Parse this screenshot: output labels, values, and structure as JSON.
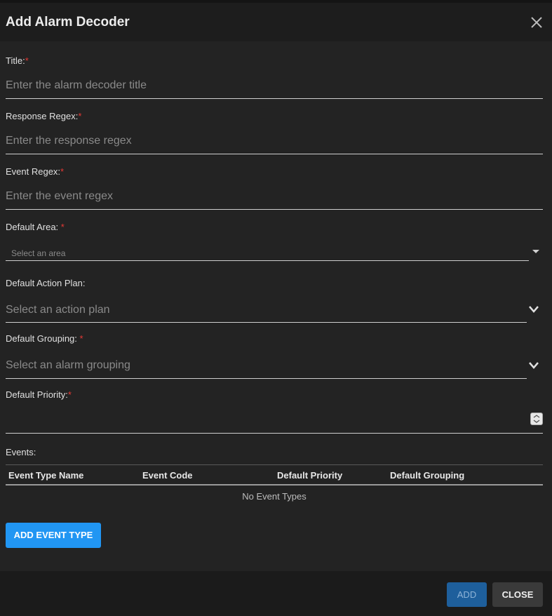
{
  "dialog": {
    "title": "Add Alarm Decoder"
  },
  "form": {
    "title": {
      "label": "Title:",
      "required_mark": "*",
      "placeholder": "Enter the alarm decoder title"
    },
    "response_regex": {
      "label": "Response Regex:",
      "required_mark": "*",
      "placeholder": "Enter the response regex"
    },
    "event_regex": {
      "label": "Event Regex:",
      "required_mark": "*",
      "placeholder": "Enter the event regex"
    },
    "default_area": {
      "label": "Default Area: ",
      "required_mark": "*",
      "placeholder": "Select an area"
    },
    "default_action_plan": {
      "label": "Default Action Plan:",
      "placeholder": "Select an action plan"
    },
    "default_grouping": {
      "label": "Default Grouping: ",
      "required_mark": "*",
      "placeholder": "Select an alarm grouping"
    },
    "default_priority": {
      "label": "Default Priority:",
      "required_mark": "*",
      "value": ""
    }
  },
  "events": {
    "label": "Events:",
    "columns": [
      "Event Type Name",
      "Event Code",
      "Default Priority",
      "Default Grouping"
    ],
    "empty_text": "No Event Types",
    "add_button": "ADD EVENT TYPE"
  },
  "footer": {
    "add_label": "ADD",
    "close_label": "CLOSE"
  },
  "colors": {
    "accent": "#2196f3",
    "required": "#e53935",
    "add_disabled": "#1e5f9c"
  }
}
